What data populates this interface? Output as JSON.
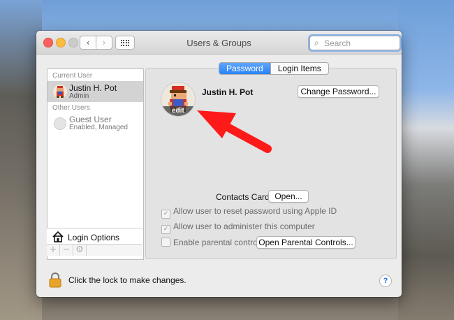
{
  "window": {
    "title": "Users & Groups"
  },
  "search": {
    "placeholder": "Search"
  },
  "sidebar": {
    "current_user_header": "Current User",
    "current_user": {
      "name": "Justin H. Pot",
      "role": "Admin"
    },
    "other_users_header": "Other Users",
    "other_users": [
      {
        "name": "Guest User",
        "status": "Enabled, Managed"
      }
    ],
    "login_options_label": "Login Options",
    "add_glyph": "+",
    "remove_glyph": "−"
  },
  "tabs": [
    {
      "label": "Password"
    },
    {
      "label": "Login Items"
    }
  ],
  "profile": {
    "full_name": "Justin H. Pot",
    "edit_label": "edit",
    "change_password_label": "Change Password..."
  },
  "contacts": {
    "label": "Contacts Card:",
    "open_label": "Open..."
  },
  "options": [
    {
      "label": "Allow user to reset password using Apple ID",
      "checked": true
    },
    {
      "label": "Allow user to administer this computer",
      "checked": true
    },
    {
      "label": "Enable parental controls",
      "checked": false
    }
  ],
  "parental": {
    "open_label": "Open Parental Controls..."
  },
  "footer": {
    "lock_text": "Click the lock to make changes.",
    "help_glyph": "?"
  },
  "icons": {
    "back": "chevron-left-icon",
    "forward": "chevron-right-icon",
    "grid": "grid-icon",
    "search": "magnifier-icon",
    "house": "house-icon",
    "lock": "lock-icon",
    "gear": "gear-icon",
    "pointer": "red-arrow-icon"
  },
  "colors": {
    "accent": "#2a84f6",
    "close": "#fc605c",
    "minimize": "#fdbc40",
    "arrow": "#ff1a1a"
  }
}
